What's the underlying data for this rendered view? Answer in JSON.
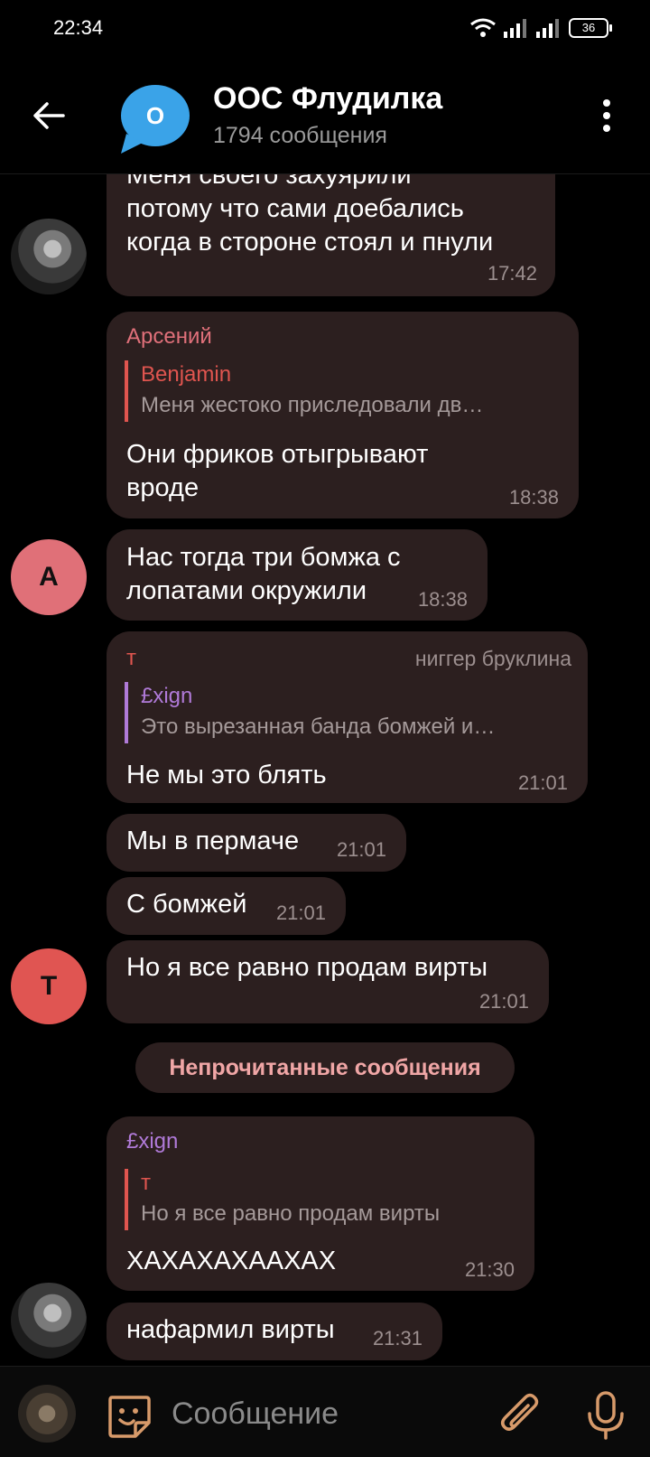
{
  "status_bar": {
    "time": "22:34",
    "battery": "36"
  },
  "header": {
    "avatar_letter": "O",
    "title": "ООС Флудилка",
    "subtitle": "1794 сообщения"
  },
  "messages": [
    {
      "lines": [
        "Меня своего захуярили",
        "потому что сами доебались",
        "когда в стороне стоял и пнули"
      ],
      "time": "17:42"
    },
    {
      "sender": "Арсений",
      "reply_name": "Benjamin",
      "reply_text": "Меня жестоко приследовали дв…",
      "lines": [
        "Они фриков отыгрывают",
        "вроде"
      ],
      "time": "18:38"
    },
    {
      "lines": [
        "Нас тогда три бомжа с",
        "лопатами окружили"
      ],
      "time": "18:38",
      "avatar_letter": "A"
    },
    {
      "sender": "т",
      "sender_tag": "ниггер бруклина",
      "reply_name": "£xign",
      "reply_text": "Это вырезанная банда бомжей и…",
      "lines": [
        "Не мы это блять"
      ],
      "time": "21:01"
    },
    {
      "lines": [
        "Мы в пермаче"
      ],
      "time": "21:01"
    },
    {
      "lines": [
        "С бомжей"
      ],
      "time": "21:01"
    },
    {
      "lines": [
        "Но я все равно продам вирты"
      ],
      "time": "21:01",
      "avatar_letter": "T"
    },
    {
      "sender": "£xign",
      "reply_name": "т",
      "reply_text": "Но я все равно продам вирты",
      "lines": [
        "ХАХАХАХААХАХ"
      ],
      "time": "21:30"
    },
    {
      "lines": [
        "нафармил вирты"
      ],
      "time": "21:31"
    }
  ],
  "unread_label": "Непрочитанные сообщения",
  "composer": {
    "placeholder": "Сообщение"
  },
  "colors": {
    "bubble": "#2c1f1f",
    "sender_arseniy": "#e0707a",
    "sender_t": "#e0554f",
    "sender_xign": "#b07ad8",
    "reply_benjamin": "#e0554f",
    "avatar_a": "#e07078",
    "avatar_t": "#e05552",
    "header_avatar": "#3aa3e8"
  }
}
